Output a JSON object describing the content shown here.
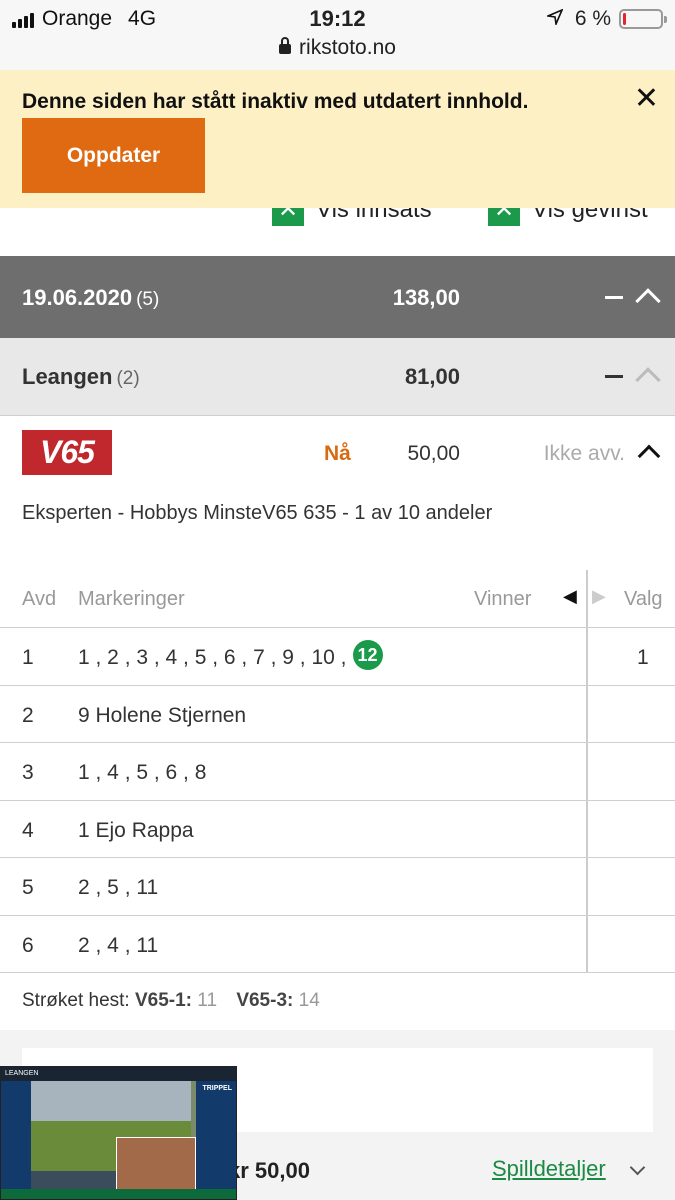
{
  "status_bar": {
    "carrier": "Orange",
    "network": "4G",
    "time": "19:12",
    "battery": "6 %",
    "battery_level_percent": 6
  },
  "browser": {
    "url": "rikstoto.no"
  },
  "notice": {
    "text": "Denne siden har stått inaktiv med utdatert innhold.",
    "update_button": "Oppdater",
    "close_symbol": "✕"
  },
  "toggles": {
    "show_stake": "Vis innsats",
    "show_winnings": "Vis gevinst"
  },
  "date_row": {
    "date": "19.06.2020",
    "count": "(5)",
    "amount": "138,00"
  },
  "track_row": {
    "name": "Leangen",
    "count": "(2)",
    "amount": "81,00"
  },
  "game": {
    "logo": "V65",
    "status": "Nå",
    "amount": "50,00",
    "result": "Ikke avv.",
    "description": "Eksperten - Hobbys MinsteV65 635 - 1 av 10 andeler"
  },
  "table": {
    "headers": {
      "avd": "Avd",
      "markings": "Markeringer",
      "winner": "Vinner",
      "choice": "Valg"
    },
    "rows": [
      {
        "avd": "1",
        "markings": "1 , 2 , 3 , 4 , 5 , 6 , 7 , 9 , 10 ,",
        "winner": "12",
        "valg": "1"
      },
      {
        "avd": "2",
        "markings": "9 Holene Stjernen",
        "winner": "",
        "valg": ""
      },
      {
        "avd": "3",
        "markings": "1 , 4 , 5 , 6 , 8",
        "winner": "",
        "valg": ""
      },
      {
        "avd": "4",
        "markings": "1 Ejo Rappa",
        "winner": "",
        "valg": ""
      },
      {
        "avd": "5",
        "markings": "2 , 5 , 11",
        "winner": "",
        "valg": ""
      },
      {
        "avd": "6",
        "markings": "2 , 4 , 11",
        "winner": "",
        "valg": ""
      }
    ]
  },
  "scratched": {
    "label": "Strøket hest:",
    "race1": "V65-1:",
    "race1_num": "11",
    "race3": "V65-3:",
    "race3_num": "14"
  },
  "footer": {
    "total": "kr 50,00",
    "details_link": "Spilldetaljer"
  },
  "video": {
    "track_label": "LEANGEN",
    "right_label": "TRIPPEL"
  },
  "colors": {
    "accent_orange": "#e06a12",
    "green": "#1b9a4b",
    "v65_red": "#c0282d",
    "notice_bg": "#fdf0c4"
  }
}
